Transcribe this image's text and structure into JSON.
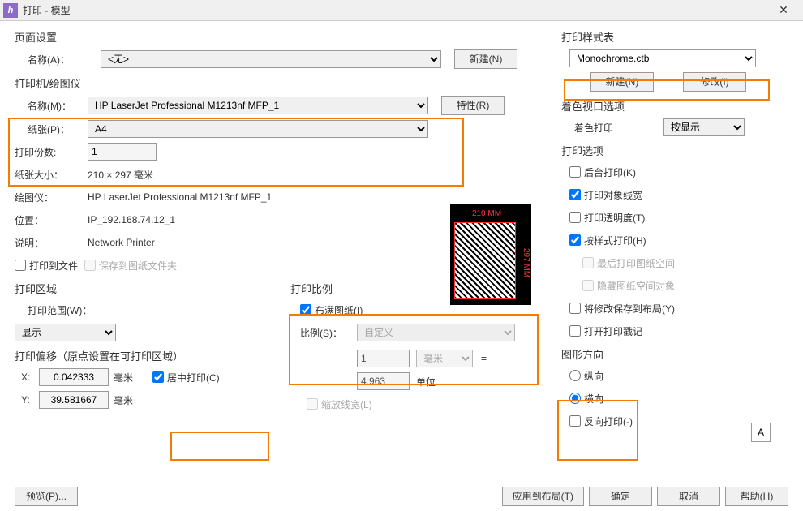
{
  "window": {
    "title": "打印 - 模型"
  },
  "pageSetup": {
    "title": "页面设置",
    "nameLabel": "名称(A)：",
    "nameValue": "<无>",
    "newBtn": "新建(N)"
  },
  "printer": {
    "title": "打印机/绘图仪",
    "nameLabel": "名称(M)：",
    "nameValue": "HP LaserJet Professional M1213nf MFP_1",
    "paperLabel": "纸张(P)：",
    "paperValue": "A4",
    "propBtn": "特性(R)",
    "copiesLabel": "打印份数:",
    "copiesValue": "1",
    "sizeLabel": "纸张大小：",
    "sizeValue": "210 × 297 毫米",
    "plotterLabel": "绘图仪：",
    "plotterValue": "HP LaserJet Professional M1213nf MFP_1",
    "locationLabel": "位置：",
    "locationValue": "IP_192.168.74.12_1",
    "descLabel": "说明：",
    "descValue": "Network Printer",
    "toFile": "打印到文件",
    "saveToFolder": "保存到图纸文件夹",
    "previewTop": "210 MM",
    "previewRight": "297 MM"
  },
  "plotArea": {
    "title": "打印区域",
    "rangeLabel": "打印范围(W)：",
    "rangeValue": "显示"
  },
  "plotOffset": {
    "title": "打印偏移（原点设置在可打印区域）",
    "xLabel": "X:",
    "xValue": "0.042333",
    "yLabel": "Y:",
    "yValue": "39.581667",
    "unit": "毫米",
    "centerPlot": "居中打印(C)"
  },
  "plotScale": {
    "title": "打印比例",
    "fitPaper": "布满图纸(I)",
    "scaleLabel": "比例(S)：",
    "scaleValue": "自定义",
    "numerator": "1",
    "numeratorUnit": "毫米",
    "equals": "=",
    "denominator": "4.963",
    "denominatorUnit": "单位",
    "scaleLineweights": "缩放线宽(L)"
  },
  "styleTable": {
    "title": "打印样式表",
    "value": "Monochrome.ctb",
    "newBtn": "新建(N)",
    "modifyBtn": "修改(I)"
  },
  "shadedViewport": {
    "title": "着色视口选项",
    "shadeLabel": "着色打印",
    "shadeValue": "按显示"
  },
  "plotOptions": {
    "title": "打印选项",
    "background": "后台打印(K)",
    "lineweights": "打印对象线宽",
    "transparency": "打印透明度(T)",
    "plotStyles": "按样式打印(H)",
    "plotPaperLast": "最后打印图纸空间",
    "hidePaperObjects": "隐藏图纸空间对象",
    "saveLayoutChanges": "将修改保存到布局(Y)",
    "plotStamp": "打开打印戳记"
  },
  "orientation": {
    "title": "图形方向",
    "portrait": "纵向",
    "landscape": "横向",
    "reverse": "反向打印(-)",
    "iconText": "A"
  },
  "bottom": {
    "preview": "预览(P)...",
    "applyLayout": "应用到布局(T)",
    "ok": "确定",
    "cancel": "取消",
    "help": "帮助(H)"
  }
}
